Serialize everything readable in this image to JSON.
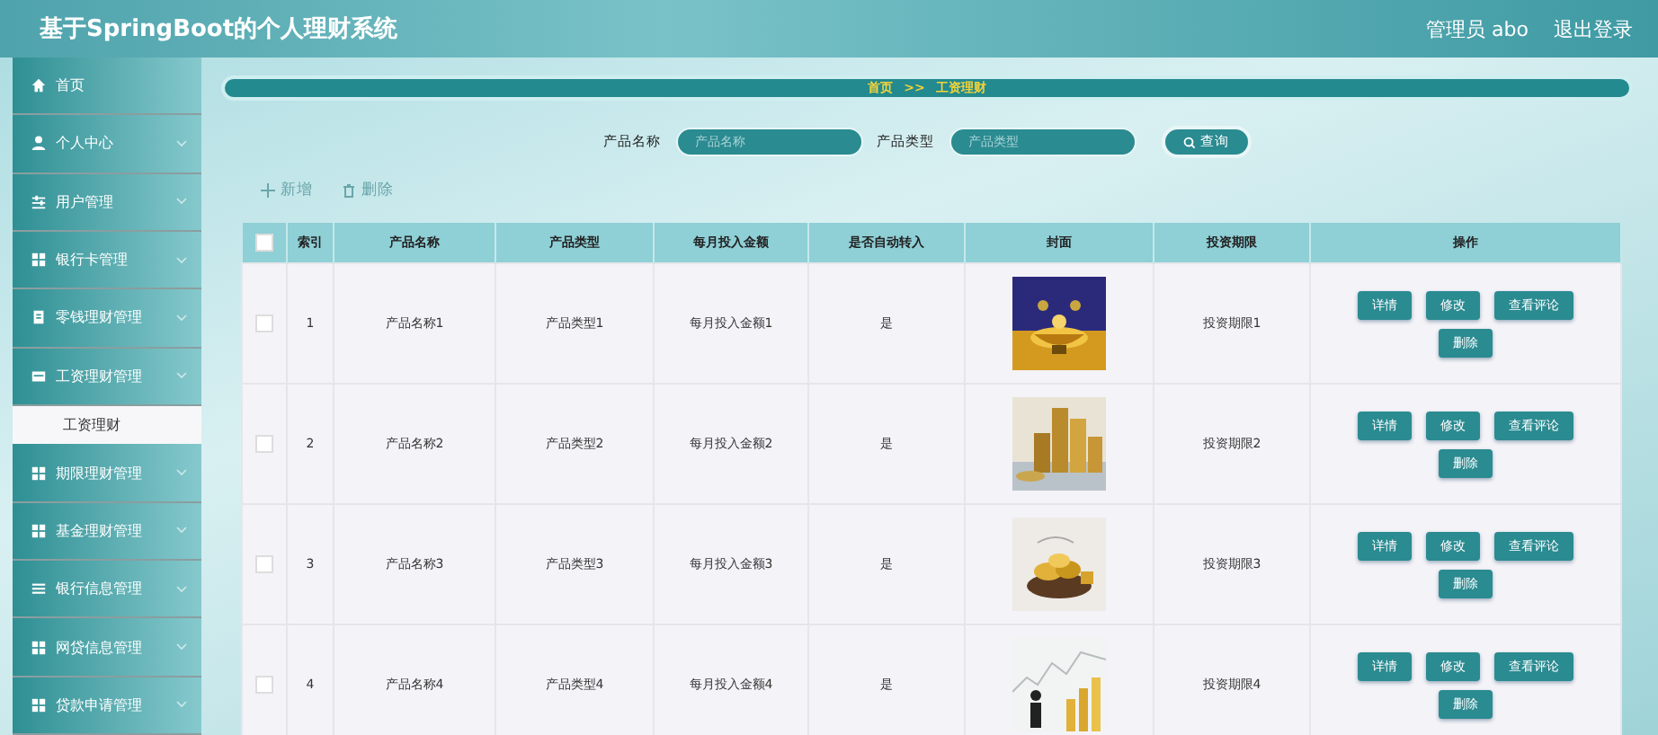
{
  "header": {
    "title": "基于SpringBoot的个人理财系统",
    "user": "管理员 abo",
    "logout": "退出登录"
  },
  "sidebar": {
    "items": [
      {
        "label": "首页",
        "has_children": false,
        "expanded": false
      },
      {
        "label": "个人中心",
        "has_children": true,
        "expanded": false
      },
      {
        "label": "用户管理",
        "has_children": true,
        "expanded": false
      },
      {
        "label": "银行卡管理",
        "has_children": true,
        "expanded": false
      },
      {
        "label": "零钱理财管理",
        "has_children": true,
        "expanded": false
      },
      {
        "label": "工资理财管理",
        "has_children": true,
        "expanded": true,
        "children": [
          {
            "label": "工资理财",
            "selected": true
          }
        ]
      },
      {
        "label": "期限理财管理",
        "has_children": true,
        "expanded": false
      },
      {
        "label": "基金理财管理",
        "has_children": true,
        "expanded": false
      },
      {
        "label": "银行信息管理",
        "has_children": true,
        "expanded": false
      },
      {
        "label": "网贷信息管理",
        "has_children": true,
        "expanded": false
      },
      {
        "label": "贷款申请管理",
        "has_children": true,
        "expanded": false
      }
    ]
  },
  "breadcrumb": {
    "home": "首页",
    "separator": ">>",
    "current": "工资理财"
  },
  "search": {
    "fields": [
      {
        "label": "产品名称",
        "placeholder": "产品名称"
      },
      {
        "label": "产品类型",
        "placeholder": "产品类型"
      }
    ],
    "button": "查询"
  },
  "toolbar": {
    "add": "新增",
    "delete": "删除"
  },
  "table": {
    "columns": [
      "索引",
      "产品名称",
      "产品类型",
      "每月投入金额",
      "是否自动转入",
      "封面",
      "投资期限",
      "操作"
    ],
    "header_checked": false,
    "rows": [
      {
        "index": "1",
        "name": "产品名称1",
        "type": "产品类型1",
        "amount": "每月投入金额1",
        "auto": "是",
        "term": "投资期限1",
        "checked": false,
        "actions": [
          "详情",
          "修改",
          "查看评论",
          "删除"
        ]
      },
      {
        "index": "2",
        "name": "产品名称2",
        "type": "产品类型2",
        "amount": "每月投入金额2",
        "auto": "是",
        "term": "投资期限2",
        "checked": false,
        "actions": [
          "详情",
          "修改",
          "查看评论",
          "删除"
        ]
      },
      {
        "index": "3",
        "name": "产品名称3",
        "type": "产品类型3",
        "amount": "每月投入金额3",
        "auto": "是",
        "term": "投资期限3",
        "checked": false,
        "actions": [
          "详情",
          "修改",
          "查看评论",
          "删除"
        ]
      },
      {
        "index": "4",
        "name": "产品名称4",
        "type": "产品类型4",
        "amount": "每月投入金额4",
        "auto": "是",
        "term": "投资期限4",
        "checked": false,
        "actions": [
          "详情",
          "修改",
          "查看评论",
          "删除"
        ]
      }
    ]
  }
}
